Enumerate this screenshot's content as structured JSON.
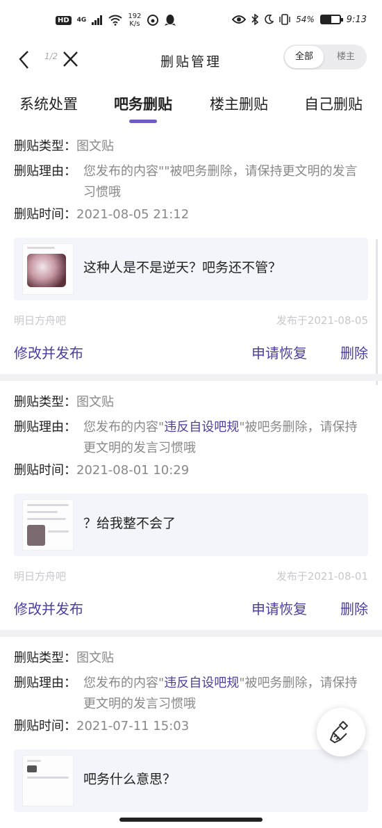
{
  "status_bar": {
    "hd": "HD",
    "net": "4G",
    "speed_value": "192",
    "speed_unit": "K/s",
    "battery": "54%",
    "time": "9:13",
    "battery_level": 0.54
  },
  "nav": {
    "page_indicator": "1/2",
    "title": "删贴管理",
    "toggle": {
      "all": "全部",
      "owner": "楼主",
      "active": "all"
    }
  },
  "tabs": [
    {
      "label": "系统处置"
    },
    {
      "label": "吧务删贴"
    },
    {
      "label": "楼主删贴"
    },
    {
      "label": "自己删贴"
    }
  ],
  "active_tab": 1,
  "labels": {
    "type": "删贴类型：",
    "reason": "删贴理由：",
    "time": "删贴时间：",
    "edit": "修改并发布",
    "restore": "申请恢复",
    "delete": "删除"
  },
  "posts": [
    {
      "type": "图文贴",
      "reason_prefix": "您发布的内容\"",
      "reason_highlight": "",
      "reason_suffix": "\"被吧务删除，请保持更文明的发言习惯哦",
      "time": "2021-08-05 21:12",
      "preview_text": "这种人是不是逆天？吧务还不管？",
      "forum": "明日方舟吧",
      "posted": "发布于2021-08-05"
    },
    {
      "type": "图文贴",
      "reason_prefix": "您发布的内容\"",
      "reason_highlight": "违反自设吧规",
      "reason_suffix": "\"被吧务删除，请保持更文明的发言习惯哦",
      "time": "2021-08-01 10:29",
      "preview_text": "？给我整不会了",
      "forum": "明日方舟吧",
      "posted": "发布于2021-08-01"
    },
    {
      "type": "图文贴",
      "reason_prefix": "您发布的内容\"",
      "reason_highlight": "违反自设吧规",
      "reason_suffix": "\"被吧务删除，请保持更文明的发言习惯哦",
      "time": "2021-07-11 15:03",
      "preview_text": "吧务什么意思？",
      "forum": "",
      "posted": ""
    }
  ],
  "colors": {
    "accent": "#6e5bc4",
    "action": "#4e3d9e",
    "muted": "#888888",
    "meta": "#c8c8cc"
  }
}
